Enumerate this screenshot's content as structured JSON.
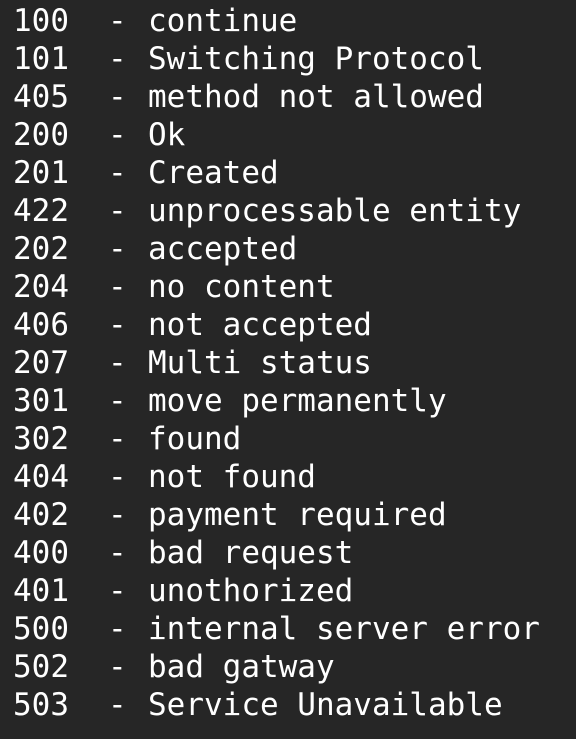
{
  "status_codes": [
    {
      "code": "100",
      "sep": "-",
      "desc": "continue"
    },
    {
      "code": "101",
      "sep": "-",
      "desc": "Switching Protocol"
    },
    {
      "code": "405",
      "sep": "-",
      "desc": "method not allowed"
    },
    {
      "code": "200",
      "sep": "-",
      "desc": "Ok"
    },
    {
      "code": "201",
      "sep": "-",
      "desc": "Created"
    },
    {
      "code": "422",
      "sep": "-",
      "desc": "unprocessable entity"
    },
    {
      "code": "202",
      "sep": "-",
      "desc": "accepted"
    },
    {
      "code": "204",
      "sep": "-",
      "desc": "no content"
    },
    {
      "code": "406",
      "sep": "-",
      "desc": "not accepted"
    },
    {
      "code": "207",
      "sep": "-",
      "desc": "Multi status"
    },
    {
      "code": "301",
      "sep": "-",
      "desc": "move permanently"
    },
    {
      "code": "302",
      "sep": "-",
      "desc": "found"
    },
    {
      "code": "404",
      "sep": "-",
      "desc": "not found"
    },
    {
      "code": "402",
      "sep": "-",
      "desc": "payment required"
    },
    {
      "code": "400",
      "sep": "-",
      "desc": "bad request"
    },
    {
      "code": "401",
      "sep": "-",
      "desc": "unothorized"
    },
    {
      "code": "500",
      "sep": "-",
      "desc": "internal server error"
    },
    {
      "code": "502",
      "sep": "-",
      "desc": "bad gatway"
    },
    {
      "code": "503",
      "sep": "-",
      "desc": "Service Unavailable"
    }
  ],
  "colors": {
    "background": "#262626",
    "text": "#ffffff"
  }
}
